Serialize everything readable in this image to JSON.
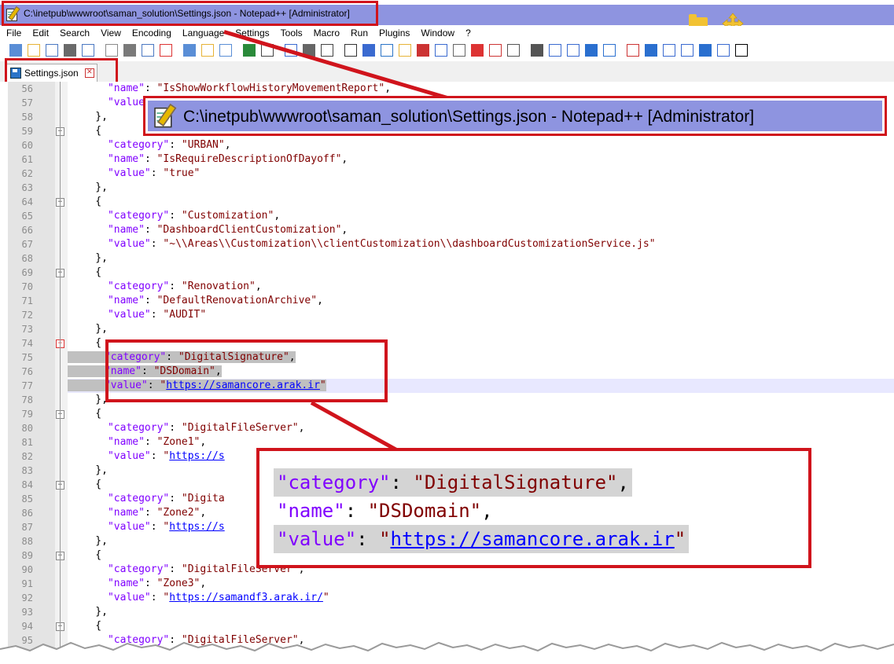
{
  "window": {
    "title": "C:\\inetpub\\wwwroot\\saman_solution\\Settings.json - Notepad++ [Administrator]"
  },
  "menu": [
    "File",
    "Edit",
    "Search",
    "View",
    "Encoding",
    "Language",
    "Settings",
    "Tools",
    "Macro",
    "Run",
    "Plugins",
    "Window",
    "?"
  ],
  "tab": {
    "label": "Settings.json"
  },
  "zoom_title": "C:\\inetpub\\wwwroot\\saman_solution\\Settings.json - Notepad++ [Administrator]",
  "lines": [
    {
      "n": "56",
      "t": "      \"name\": \"IsShowWorkflowHistoryMovementReport\","
    },
    {
      "n": "57",
      "t": "      \"value\": \"true\""
    },
    {
      "n": "58",
      "t": "    },"
    },
    {
      "n": "59",
      "t": "    {"
    },
    {
      "n": "60",
      "t": "      \"category\": \"URBAN\","
    },
    {
      "n": "61",
      "t": "      \"name\": \"IsRequireDescriptionOfDayoff\","
    },
    {
      "n": "62",
      "t": "      \"value\": \"true\""
    },
    {
      "n": "63",
      "t": "    },"
    },
    {
      "n": "64",
      "t": "    {"
    },
    {
      "n": "65",
      "t": "      \"category\": \"Customization\","
    },
    {
      "n": "66",
      "t": "      \"name\": \"DashboardClientCustomization\","
    },
    {
      "n": "67",
      "t": "      \"value\": \"~\\\\Areas\\\\Customization\\\\clientCustomization\\\\dashboardCustomizationService.js\""
    },
    {
      "n": "68",
      "t": "    },"
    },
    {
      "n": "69",
      "t": "    {"
    },
    {
      "n": "70",
      "t": "      \"category\": \"Renovation\","
    },
    {
      "n": "71",
      "t": "      \"name\": \"DefaultRenovationArchive\","
    },
    {
      "n": "72",
      "t": "      \"value\": \"AUDIT\""
    },
    {
      "n": "73",
      "t": "    },"
    },
    {
      "n": "74",
      "t": "    {"
    },
    {
      "n": "75",
      "t": "      \"category\": \"DigitalSignature\","
    },
    {
      "n": "76",
      "t": "      \"name\": \"DSDomain\","
    },
    {
      "n": "77",
      "t": "      \"value\": \"https://samancore.arak.ir\""
    },
    {
      "n": "78",
      "t": "    },"
    },
    {
      "n": "79",
      "t": "    {"
    },
    {
      "n": "80",
      "t": "      \"category\": \"DigitalFileServer\","
    },
    {
      "n": "81",
      "t": "      \"name\": \"Zone1\","
    },
    {
      "n": "82",
      "t": "      \"value\": \"https://s"
    },
    {
      "n": "83",
      "t": "    },"
    },
    {
      "n": "84",
      "t": "    {"
    },
    {
      "n": "85",
      "t": "      \"category\": \"Digita"
    },
    {
      "n": "86",
      "t": "      \"name\": \"Zone2\","
    },
    {
      "n": "87",
      "t": "      \"value\": \"https://s"
    },
    {
      "n": "88",
      "t": "    },"
    },
    {
      "n": "89",
      "t": "    {"
    },
    {
      "n": "90",
      "t": "      \"category\": \"DigitalFileServer\","
    },
    {
      "n": "91",
      "t": "      \"name\": \"Zone3\","
    },
    {
      "n": "92",
      "t": "      \"value\": \"https://samandf3.arak.ir/\""
    },
    {
      "n": "93",
      "t": "    },"
    },
    {
      "n": "94",
      "t": "    {"
    },
    {
      "n": "95",
      "t": "      \"category\": \"DigitalFileServer\","
    }
  ],
  "zoom_lines": [
    {
      "key": "\"category\"",
      "sep": ": ",
      "val": "\"DigitalSignature\"",
      "end": ","
    },
    {
      "key": "\"name\"",
      "sep": ": ",
      "val": "\"DSDomain\"",
      "end": ","
    },
    {
      "key": "\"value\"",
      "sep": ": ",
      "val": "\"",
      "url": "https://samancore.arak.ir",
      "end": "\""
    }
  ],
  "colors": {
    "accent_red": "#d0141c",
    "titlebar": "#8e94e0",
    "keyword": "#8000ff",
    "string": "#800000",
    "url": "#0000ff"
  }
}
